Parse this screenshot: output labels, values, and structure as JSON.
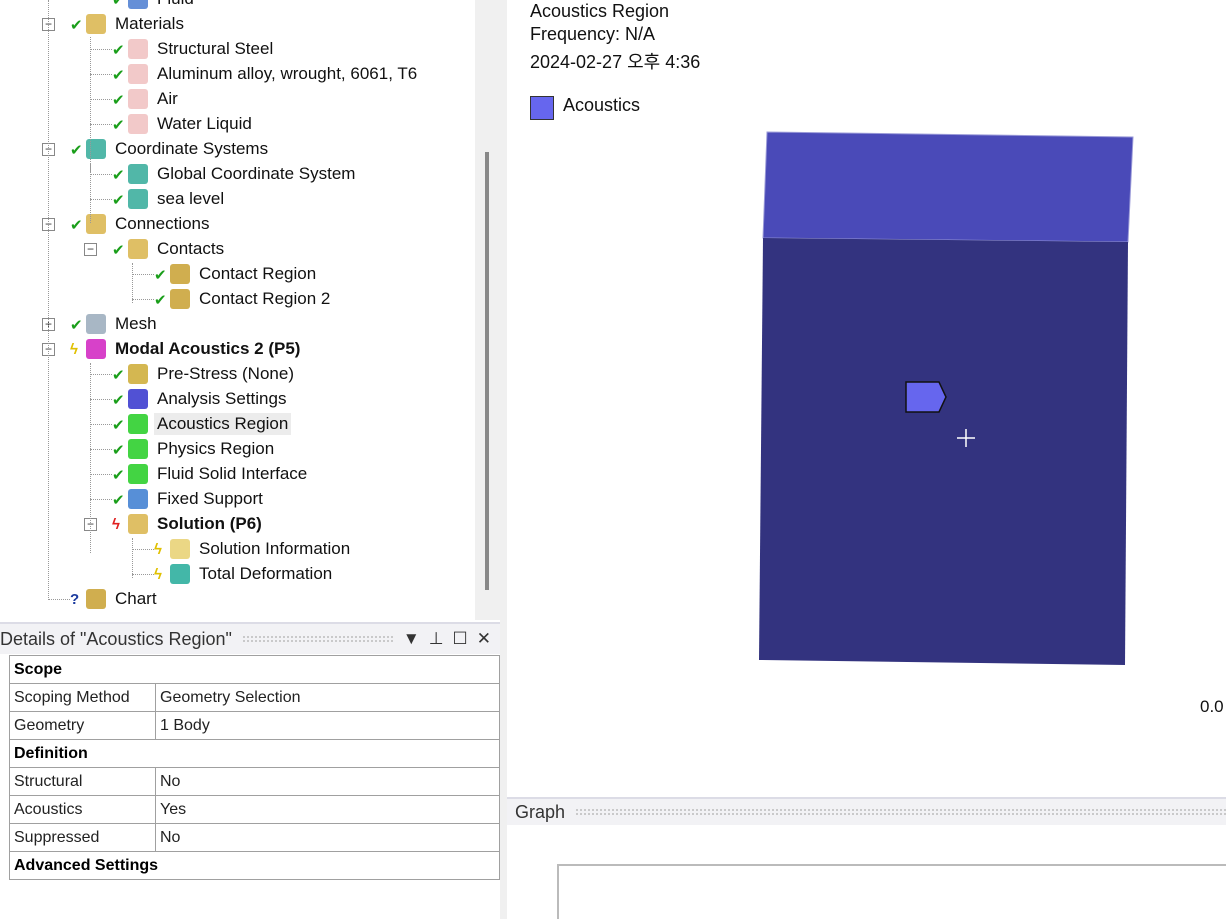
{
  "tree": [
    {
      "label": "Fluid",
      "level": 2,
      "status": "check",
      "icon": "body-icon",
      "partial": true
    },
    {
      "label": "Materials",
      "level": 1,
      "status": "check",
      "icon": "materials-folder-icon",
      "exp": "-"
    },
    {
      "label": "Structural Steel",
      "level": 2,
      "status": "check",
      "icon": "material-tag-icon"
    },
    {
      "label": "Aluminum alloy, wrought, 6061, T6",
      "level": 2,
      "status": "check",
      "icon": "material-tag-icon"
    },
    {
      "label": "Air",
      "level": 2,
      "status": "check",
      "icon": "material-tag-icon"
    },
    {
      "label": "Water Liquid",
      "level": 2,
      "status": "check",
      "icon": "material-tag-icon"
    },
    {
      "label": "Coordinate Systems",
      "level": 1,
      "status": "check",
      "icon": "coordinate-system-icon",
      "exp": "-"
    },
    {
      "label": "Global Coordinate System",
      "level": 2,
      "status": "check",
      "icon": "coordinate-system-icon"
    },
    {
      "label": "sea level",
      "level": 2,
      "status": "check",
      "icon": "coordinate-system-icon"
    },
    {
      "label": "Connections",
      "level": 1,
      "status": "check",
      "icon": "connections-folder-icon",
      "exp": "-"
    },
    {
      "label": "Contacts",
      "level": 2,
      "status": "check",
      "icon": "contacts-folder-icon",
      "exp": "-"
    },
    {
      "label": "Contact Region",
      "level": 3,
      "status": "check",
      "icon": "contact-region-icon"
    },
    {
      "label": "Contact Region 2",
      "level": 3,
      "status": "check",
      "icon": "contact-region-icon"
    },
    {
      "label": "Mesh",
      "level": 1,
      "status": "check",
      "icon": "mesh-icon",
      "exp": "+"
    },
    {
      "label": "Modal Acoustics 2 (P5)",
      "level": 1,
      "status": "bolt",
      "icon": "modal-acoustics-icon",
      "exp": "-",
      "bold": true
    },
    {
      "label": "Pre-Stress (None)",
      "level": 2,
      "status": "check",
      "icon": "pre-stress-icon"
    },
    {
      "label": "Analysis Settings",
      "level": 2,
      "status": "check",
      "icon": "analysis-settings-icon"
    },
    {
      "label": "Acoustics Region",
      "level": 2,
      "status": "check",
      "icon": "acoustics-region-icon",
      "selected": true
    },
    {
      "label": "Physics Region",
      "level": 2,
      "status": "check",
      "icon": "physics-region-icon"
    },
    {
      "label": "Fluid Solid Interface",
      "level": 2,
      "status": "check",
      "icon": "fluid-solid-interface-icon"
    },
    {
      "label": "Fixed Support",
      "level": 2,
      "status": "check",
      "icon": "fixed-support-icon"
    },
    {
      "label": "Solution (P6)",
      "level": 2,
      "status": "redbolt",
      "icon": "solution-folder-icon",
      "exp": "-",
      "bold": true
    },
    {
      "label": "Solution Information",
      "level": 3,
      "status": "bolt",
      "icon": "solution-information-icon"
    },
    {
      "label": "Total Deformation",
      "level": 3,
      "status": "bolt",
      "icon": "total-deformation-icon"
    },
    {
      "label": "Chart",
      "level": 1,
      "status": "question",
      "icon": "chart-icon"
    }
  ],
  "details": {
    "title": "Details of \"Acoustics Region\"",
    "groups": [
      {
        "name": "Scope",
        "rows": [
          [
            "Scoping Method",
            "Geometry Selection"
          ],
          [
            "Geometry",
            "1 Body"
          ]
        ]
      },
      {
        "name": "Definition",
        "rows": [
          [
            "Structural",
            "No"
          ],
          [
            "Acoustics",
            "Yes"
          ],
          [
            "Suppressed",
            "No"
          ]
        ]
      },
      {
        "name": "Advanced Settings",
        "rows": []
      }
    ]
  },
  "viewport": {
    "title": "Acoustics Region",
    "frequency": "Frequency: N/A",
    "timestamp": "2024-02-27 오후 4:36",
    "legend_label": "Acoustics",
    "legend_color": "#6666ee",
    "scale_label": "0.0"
  },
  "graph": {
    "title": "Graph"
  }
}
